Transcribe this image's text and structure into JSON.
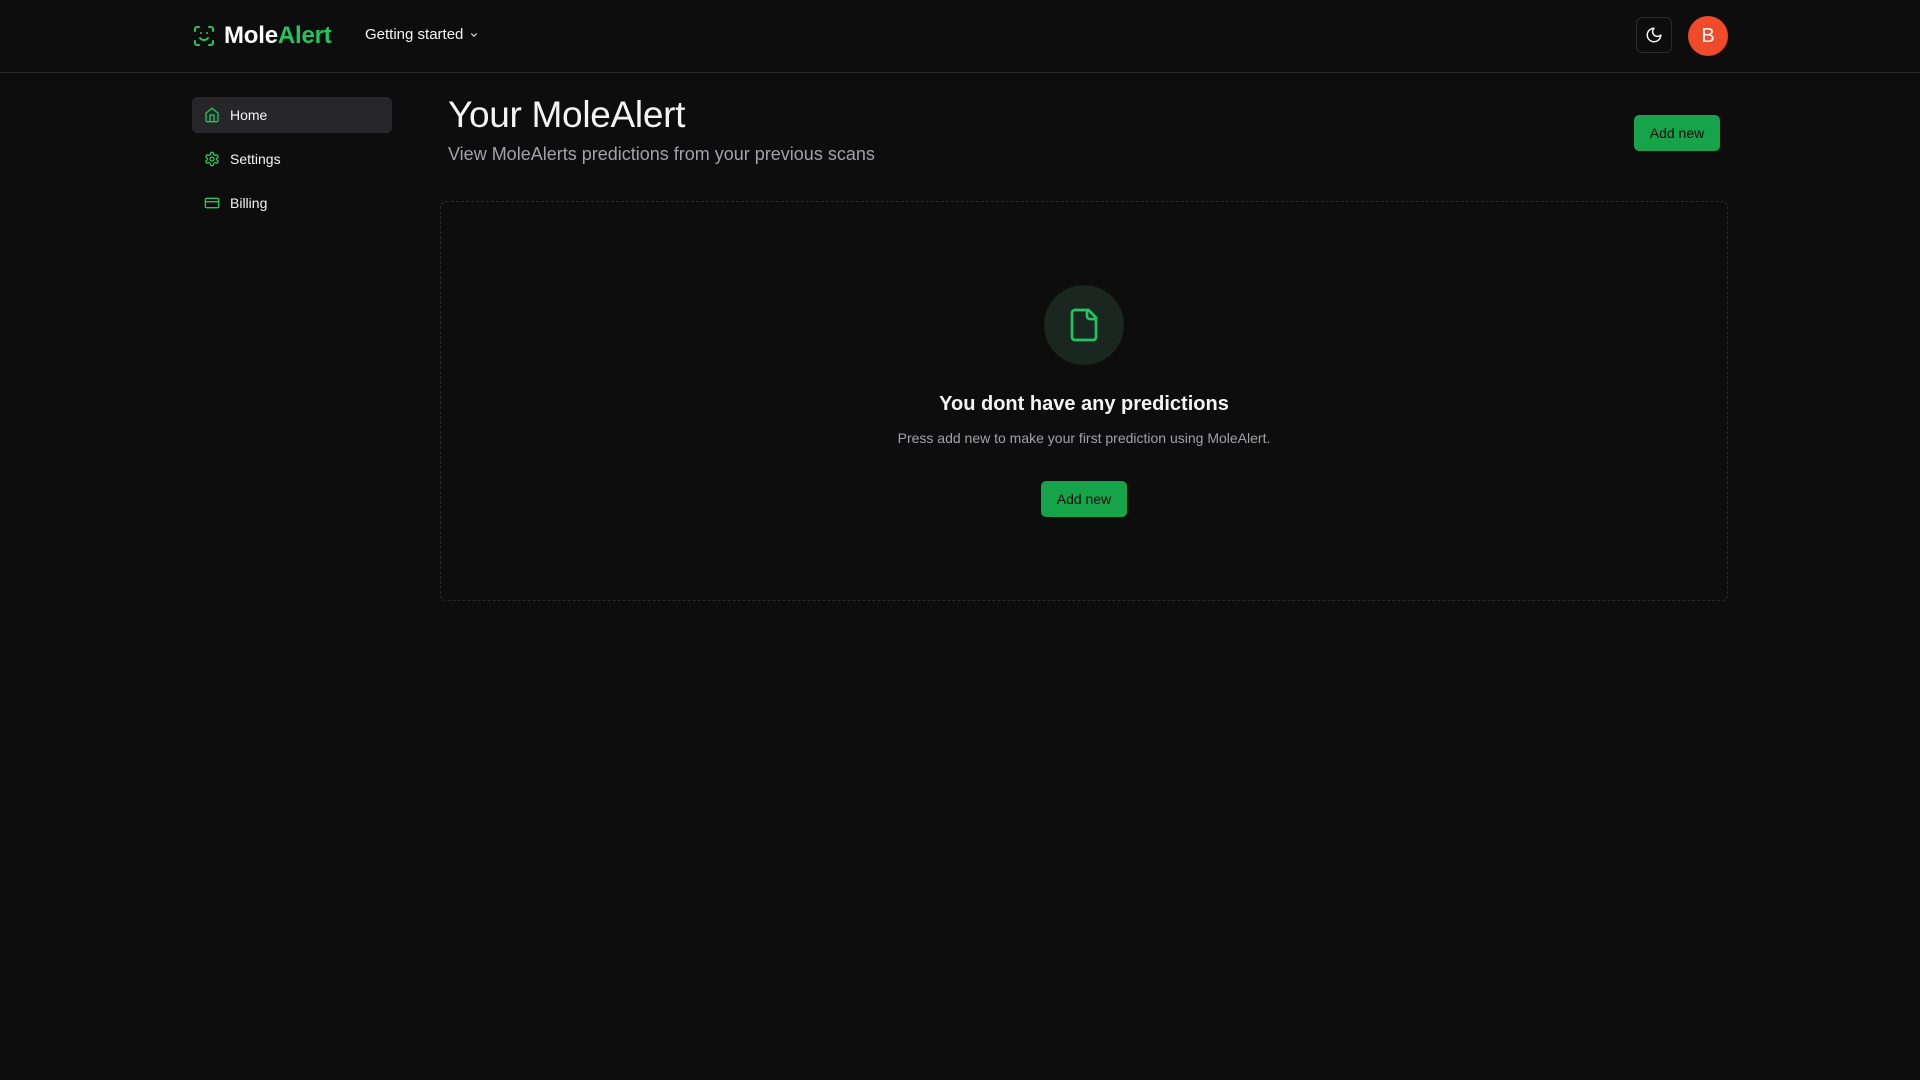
{
  "header": {
    "logo_part1": "Mole",
    "logo_part2": "Alert",
    "nav_getting_started": "Getting started",
    "avatar_initial": "B"
  },
  "sidebar": {
    "items": [
      {
        "label": "Home",
        "icon": "home-icon",
        "active": true
      },
      {
        "label": "Settings",
        "icon": "gear-icon",
        "active": false
      },
      {
        "label": "Billing",
        "icon": "credit-card-icon",
        "active": false
      }
    ]
  },
  "main": {
    "title": "Your MoleAlert",
    "subtitle": "View MoleAlerts predictions from your previous scans",
    "add_new_label": "Add new",
    "empty_state": {
      "icon": "file-icon",
      "title": "You dont have any predictions",
      "description": "Press add new to make your first prediction using MoleAlert.",
      "button_label": "Add new"
    }
  },
  "colors": {
    "background": "#0e0d0e",
    "accent": "#22c55e",
    "button": "#16a34a",
    "avatar": "#ef4a2a",
    "active_item": "#27272a",
    "muted_text": "#a1a1aa"
  }
}
